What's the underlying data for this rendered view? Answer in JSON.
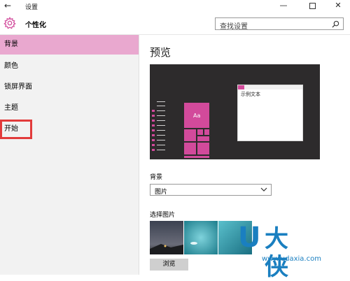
{
  "window": {
    "back_glyph": "←",
    "title": "设置",
    "minimize_glyph": "—",
    "close_glyph": "✕"
  },
  "header": {
    "title": "个性化",
    "search_placeholder": "查找设置"
  },
  "sidebar": {
    "items": [
      {
        "label": "背景",
        "active": true
      },
      {
        "label": "颜色"
      },
      {
        "label": "锁屏界面"
      },
      {
        "label": "主题"
      },
      {
        "label": "开始",
        "highlighted_box": true
      }
    ]
  },
  "main": {
    "preview_title": "预览",
    "preview_sample_text": "示例文本",
    "preview_tile_text": "Aa",
    "background_label": "背景",
    "background_value": "图片",
    "choose_picture_label": "选择图片",
    "browse_label": "浏览"
  },
  "watermark": {
    "logo_letter": "U",
    "logo_text": "大侠",
    "url": "www.udaxia.com"
  },
  "colors": {
    "accent": "#d24a9b",
    "sidebar_active": "#e9a8cf",
    "highlight_box": "#e23b3b",
    "watermark": "#1a7fc0"
  }
}
